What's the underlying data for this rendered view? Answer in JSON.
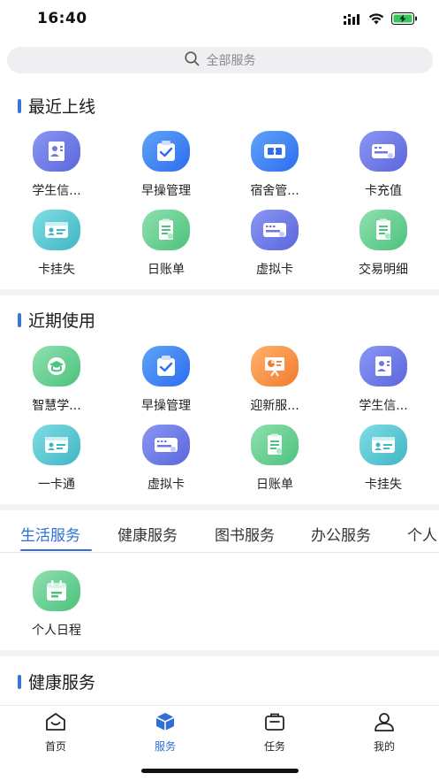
{
  "status": {
    "time": "16:40",
    "signal_icon": "signal-icon",
    "wifi_icon": "wifi-icon",
    "battery_icon": "battery-charging-icon"
  },
  "search": {
    "placeholder": "全部服务",
    "icon": "search-icon"
  },
  "recent_online": {
    "title": "最近上线",
    "items": [
      {
        "label": "学生信...",
        "icon": "student-id-icon",
        "color": "purple"
      },
      {
        "label": "早操管理",
        "icon": "clipboard-check-icon",
        "color": "blue"
      },
      {
        "label": "宿舍管...",
        "icon": "dorm-icon",
        "color": "blue"
      },
      {
        "label": "卡充值",
        "icon": "card-recharge-icon",
        "color": "purple"
      },
      {
        "label": "卡挂失",
        "icon": "id-card-icon",
        "color": "teal"
      },
      {
        "label": "日账单",
        "icon": "bill-icon",
        "color": "green"
      },
      {
        "label": "虚拟卡",
        "icon": "virtual-card-icon",
        "color": "purple"
      },
      {
        "label": "交易明细",
        "icon": "transaction-icon",
        "color": "green"
      }
    ]
  },
  "recent_used": {
    "title": "近期使用",
    "items": [
      {
        "label": "智慧学...",
        "icon": "graduation-icon",
        "color": "green"
      },
      {
        "label": "早操管理",
        "icon": "clipboard-check-icon",
        "color": "blue"
      },
      {
        "label": "迎新服...",
        "icon": "presentation-icon",
        "color": "orange"
      },
      {
        "label": "学生信...",
        "icon": "student-id-icon",
        "color": "purple"
      },
      {
        "label": "一卡通",
        "icon": "id-card-icon",
        "color": "teal"
      },
      {
        "label": "虚拟卡",
        "icon": "virtual-card-icon",
        "color": "purple"
      },
      {
        "label": "日账单",
        "icon": "bill-icon",
        "color": "green"
      },
      {
        "label": "卡挂失",
        "icon": "id-card-icon",
        "color": "teal"
      }
    ]
  },
  "service_tabs": [
    "生活服务",
    "健康服务",
    "图书服务",
    "办公服务",
    "个人"
  ],
  "active_tab_items": [
    {
      "label": "个人日程",
      "icon": "calendar-icon",
      "color": "green"
    }
  ],
  "health_section": {
    "title": "健康服务"
  },
  "bottom_nav": [
    {
      "label": "首页",
      "icon": "home-icon"
    },
    {
      "label": "服务",
      "icon": "services-cube-icon",
      "active": true
    },
    {
      "label": "任务",
      "icon": "task-icon"
    },
    {
      "label": "我的",
      "icon": "profile-icon"
    }
  ],
  "colors": {
    "accent": "#2f6fd6",
    "section_bar": "#3a74d6"
  }
}
